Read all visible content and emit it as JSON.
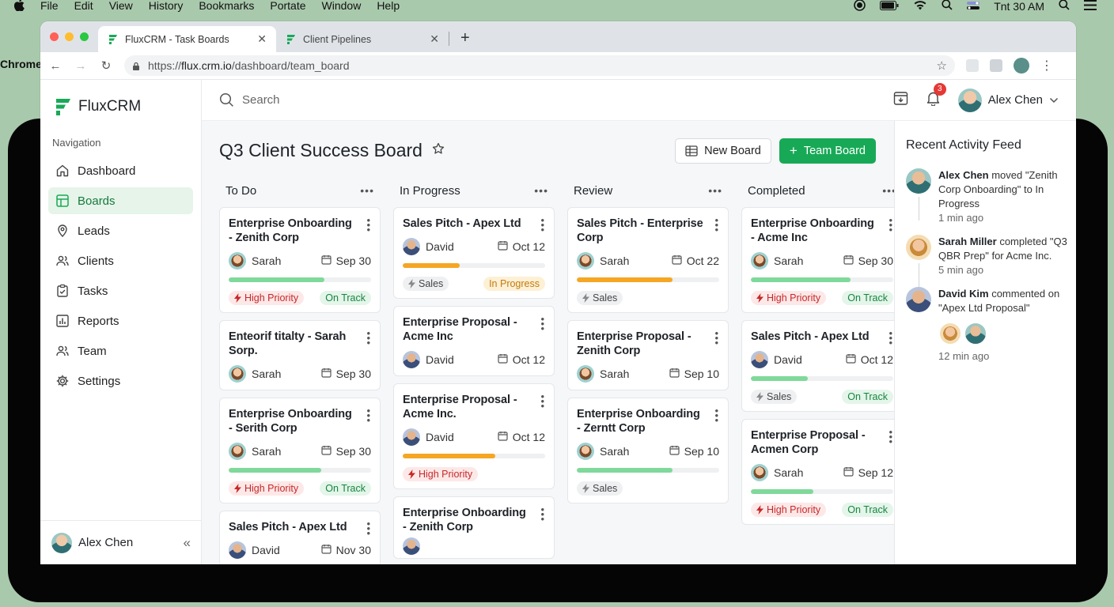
{
  "menubar": {
    "app": "Chrome",
    "items": [
      "File",
      "Edit",
      "View",
      "History",
      "Bookmarks",
      "Portate",
      "Window",
      "Help"
    ],
    "clock": "Tnt 30 AM"
  },
  "browser": {
    "tabs": [
      {
        "title": "FluxCRM - Task Boards"
      },
      {
        "title": "Client Pipelines"
      }
    ],
    "url_prefix": "https://",
    "url_host": "flux.crm.io",
    "url_path": "/dashboard/team_board"
  },
  "brand": {
    "name": "FluxCRM",
    "color": "#18a957"
  },
  "sidebar": {
    "section_label": "Navigation",
    "items": [
      {
        "label": "Dashboard",
        "icon": "home-icon"
      },
      {
        "label": "Boards",
        "icon": "board-icon"
      },
      {
        "label": "Leads",
        "icon": "location-pin-icon"
      },
      {
        "label": "Clients",
        "icon": "users-icon"
      },
      {
        "label": "Tasks",
        "icon": "clipboard-check-icon"
      },
      {
        "label": "Reports",
        "icon": "bar-chart-icon"
      },
      {
        "label": "Team",
        "icon": "users-icon"
      },
      {
        "label": "Settings",
        "icon": "gear-icon"
      }
    ],
    "active_item": "Boards",
    "footer_user": "Alex Chen"
  },
  "topbar": {
    "search_placeholder": "Search",
    "notification_count": "3",
    "user_name": "Alex Chen"
  },
  "board": {
    "title": "Q3 Client Success Board",
    "new_board_label": "New Board",
    "team_board_label": "Team Board",
    "columns": [
      {
        "title": "To Do",
        "cards": [
          {
            "title": "Enterprise Onboarding - Zenith Corp",
            "assignee": "Sarah",
            "date": "Sep 30",
            "progress": 0.67,
            "progress_color": "#7fd99a",
            "tags": [
              "High Priority",
              "On Track"
            ]
          },
          {
            "title": "Enteorif titalty - Sarah Sorp.",
            "assignee": "Sarah",
            "date": "Sep 30",
            "progress": null,
            "tags": []
          },
          {
            "title": "Enterprise Onboarding - Serith Corp",
            "assignee": "Sarah",
            "date": "Sep 30",
            "progress": 0.65,
            "progress_color": "#7fd99a",
            "tags": [
              "High Priority",
              "On Track"
            ]
          },
          {
            "title": "Sales Pitch - Apex Ltd",
            "assignee": "David",
            "date": "Nov 30",
            "progress": null,
            "tags": []
          }
        ]
      },
      {
        "title": "In Progress",
        "cards": [
          {
            "title": "Sales Pitch - Apex Ltd",
            "assignee": "David",
            "date": "Oct 12",
            "progress": 0.4,
            "progress_color": "#f5a623",
            "tags": [
              "Sales",
              "In Progress"
            ]
          },
          {
            "title": "Enterprise Proposal - Acme Inc",
            "assignee": "David",
            "date": "Oct 12",
            "progress": null,
            "tags": []
          },
          {
            "title": "Enterprise Proposal - Acme Inc.",
            "assignee": "David",
            "date": "Oct 12",
            "progress": 0.65,
            "progress_color": "#f5a623",
            "tags": [
              "High Priority"
            ]
          },
          {
            "title": "Enterprise Onboarding - Zenith Corp",
            "assignee": "",
            "date": "",
            "progress": null,
            "tags": []
          }
        ]
      },
      {
        "title": "Review",
        "cards": [
          {
            "title": "Sales Pitch - Enterprise Corp",
            "assignee": "Sarah",
            "date": "Oct 22",
            "progress": 0.67,
            "progress_color": "#f5a623",
            "tags": [
              "Sales"
            ]
          },
          {
            "title": "Enterprise Proposal - Zenith Corp",
            "assignee": "Sarah",
            "date": "Sep 10",
            "progress": null,
            "tags": []
          },
          {
            "title": "Enterprise Onboarding - Zerntt Corp",
            "assignee": "Sarah",
            "date": "Sep 10",
            "progress": 0.67,
            "progress_color": "#7fd99a",
            "tags": [
              "Sales"
            ]
          }
        ]
      },
      {
        "title": "Completed",
        "cards": [
          {
            "title": "Enterprise Onboarding - Acme Inc",
            "assignee": "Sarah",
            "date": "Sep 30",
            "progress": 0.7,
            "progress_color": "#7fd99a",
            "tags": [
              "High Priority",
              "On Track"
            ]
          },
          {
            "title": "Sales Pitch - Apex Ltd",
            "assignee": "David",
            "date": "Oct 12",
            "progress": 0.4,
            "progress_color": "#7fd99a",
            "tags": [
              "Sales",
              "On Track"
            ]
          },
          {
            "title": "Enterprise Proposal - Acmen Corp",
            "assignee": "Sarah",
            "date": "Sep 12",
            "progress": 0.44,
            "progress_color": "#7fd99a",
            "tags": [
              "High Priority",
              "On Track"
            ]
          }
        ]
      }
    ]
  },
  "activity": {
    "title": "Recent Activity Feed",
    "items": [
      {
        "actor": "Alex Chen",
        "text": " moved \"Zenith Corp Onboarding\" to In Progress",
        "time": "1 min ago"
      },
      {
        "actor": "Sarah Miller",
        "text": " completed \"Q3 QBR Prep\" for Acme Inc.",
        "time": "5 min ago"
      },
      {
        "actor": "David Kim",
        "text": " commented on \"Apex Ltd Proposal\"",
        "time": "12 min ago"
      }
    ]
  },
  "colors": {
    "accent": "#18a957",
    "high_priority": "#c62828",
    "on_track": "#17853f",
    "in_progress": "#c27b0c"
  }
}
